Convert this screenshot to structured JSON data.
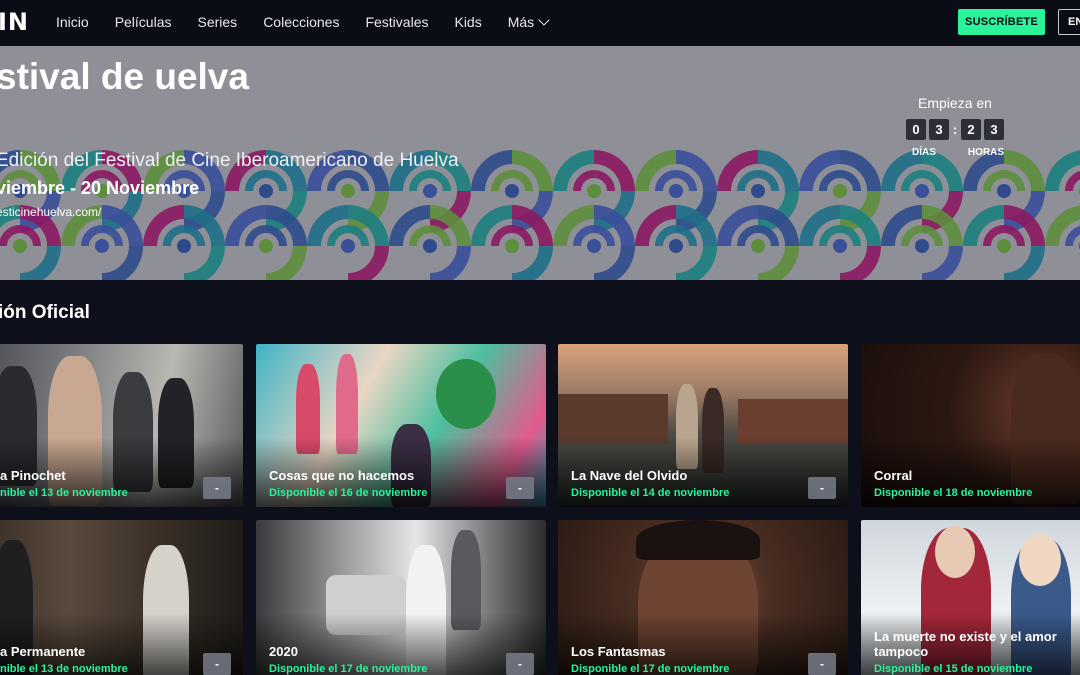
{
  "nav": {
    "logo": "IN",
    "links": [
      "Inicio",
      "Películas",
      "Series",
      "Colecciones",
      "Festivales",
      "Kids"
    ],
    "more_label": "Más",
    "subscribe_label": "SUSCRÍBETE",
    "enter_label": "EN"
  },
  "hero": {
    "title": "stival de uelva",
    "subtitle": "Edición del Festival de Cine Iberoamericano de Huelva",
    "dates": "viembre - 20 Noviembre",
    "url": "esticinehuelva.com/",
    "countdown": {
      "label": "Empieza en",
      "days_digits": [
        "0",
        "3"
      ],
      "hours_digits": [
        "2",
        "3"
      ],
      "separator": ":",
      "days_label": "DÍAS",
      "hours_label": "HORAS"
    },
    "pattern_colors": [
      "#2f4b8c",
      "#1c7f7e",
      "#5e8e3c",
      "#8c1a62",
      "#3a4f9a",
      "#1f6e88"
    ]
  },
  "section": {
    "title": "ión Oficial"
  },
  "cards": [
    {
      "title": "a Pinochet",
      "avail": "nible el 13 de noviembre",
      "btn": "-"
    },
    {
      "title": "Cosas que no hacemos",
      "avail": "Disponible el 16 de noviembre",
      "btn": "-"
    },
    {
      "title": "La Nave del Olvido",
      "avail": "Disponible el 14 de noviembre",
      "btn": "-"
    },
    {
      "title": "Corral",
      "avail": "Disponible el 18 de noviembre",
      "btn": "-"
    },
    {
      "title": "a Permanente",
      "avail": "nible el 13 de noviembre",
      "btn": "-"
    },
    {
      "title": "2020",
      "avail": "Disponible el 17 de noviembre",
      "btn": "-"
    },
    {
      "title": "Los Fantasmas",
      "avail": "Disponible el 17 de noviembre",
      "btn": "-"
    },
    {
      "title": "La muerte no existe y el amor tampoco",
      "avail": "Disponible el 15 de noviembre",
      "btn": "-"
    }
  ],
  "colors": {
    "accent": "#2bf39a",
    "background": "#0d0f1a",
    "nav": "#0a0c16"
  }
}
